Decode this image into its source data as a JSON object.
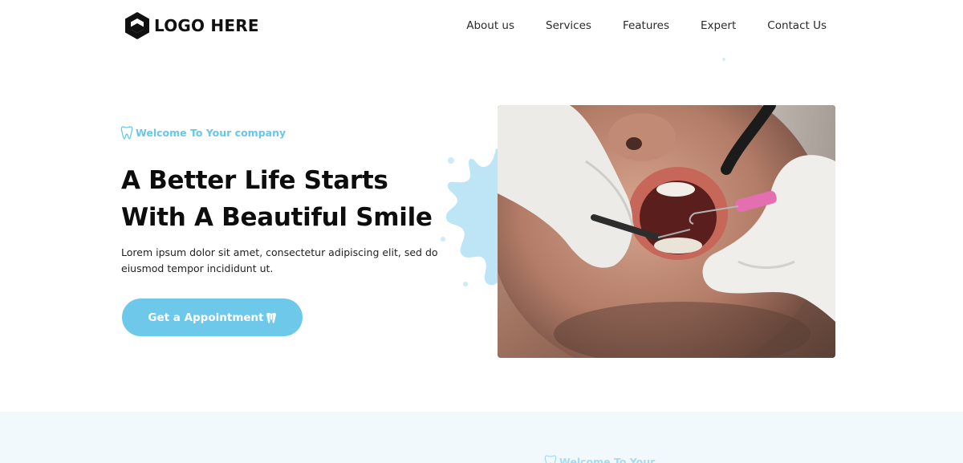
{
  "header": {
    "logo_text": "LOGO HERE",
    "logo_icon": "hexagon-logo-icon",
    "nav": [
      {
        "label": "About us"
      },
      {
        "label": "Services"
      },
      {
        "label": "Features"
      },
      {
        "label": "Expert"
      },
      {
        "label": "Contact Us"
      }
    ]
  },
  "hero": {
    "eyebrow": "Welcome To Your company",
    "eyebrow_icon": "tooth-icon",
    "title_line1": "A Better Life Starts",
    "title_line2": "With A Beautiful Smile",
    "description": "Lorem ipsum dolor sit amet, consectetur adipiscing elit, sed do eiusmod tempor incididunt ut.",
    "cta_label": "Get a Appointment",
    "cta_icon": "tooth-icon",
    "image_alt": "Dentist examining patient's teeth"
  },
  "next_section": {
    "eyebrow": "Welcome To Your"
  },
  "colors": {
    "accent": "#6ec8ea",
    "accent_text": "#67c7ea",
    "band": "#f1f9fd",
    "heading": "#0d0d0d"
  }
}
